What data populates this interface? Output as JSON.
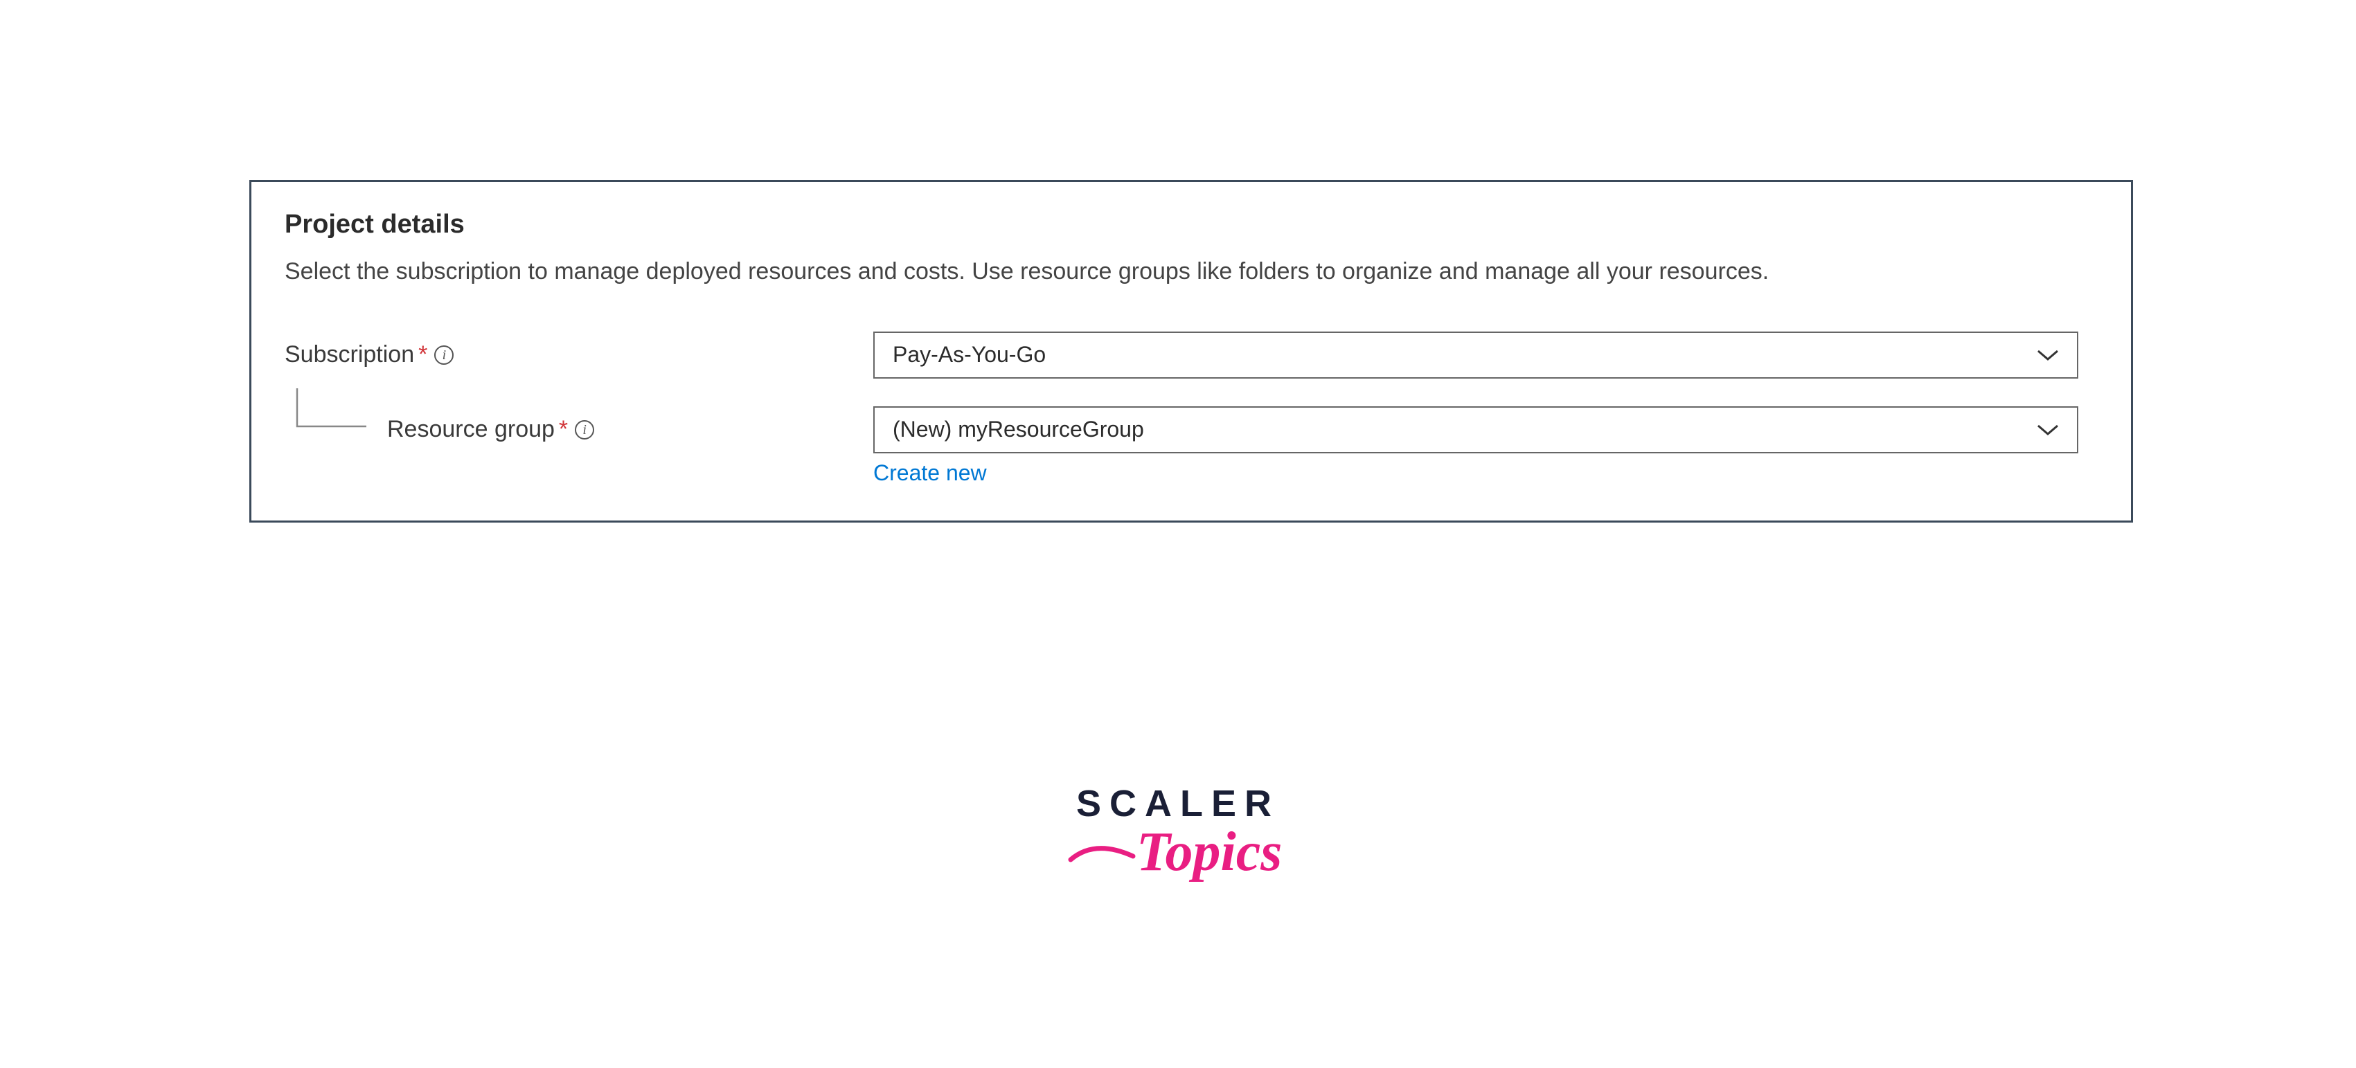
{
  "section": {
    "title": "Project details",
    "description": "Select the subscription to manage deployed resources and costs. Use resource groups like folders to organize and manage all your resources."
  },
  "fields": {
    "subscription": {
      "label": "Subscription",
      "required_marker": "*",
      "value": "Pay-As-You-Go"
    },
    "resource_group": {
      "label": "Resource group",
      "required_marker": "*",
      "value": "(New) myResourceGroup",
      "create_new_link": "Create new"
    }
  },
  "watermark": {
    "line1": "SCALER",
    "line2": "Topics"
  }
}
